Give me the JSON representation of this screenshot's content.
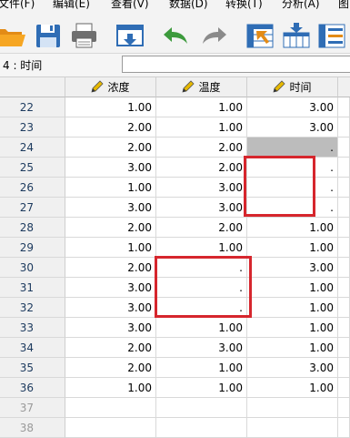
{
  "menu": [
    "文件(F)",
    "编辑(E)",
    "查看(V)",
    "数据(D)",
    "转换(T)",
    "分析(A)",
    "图"
  ],
  "toolbar": [
    "folder-open-icon",
    "save-icon",
    "print-icon",
    "dialog-recall-icon",
    "undo-icon",
    "redo-icon",
    "goto-case-icon",
    "goto-variable-icon",
    "variables-icon"
  ],
  "cell_ref": "4 : 时间",
  "cell_value": "",
  "columns": [
    "浓度",
    "温度",
    "时间"
  ],
  "rows": [
    {
      "n": "22",
      "c": [
        "1.00",
        "1.00",
        "3.00"
      ]
    },
    {
      "n": "23",
      "c": [
        "2.00",
        "1.00",
        "3.00"
      ]
    },
    {
      "n": "24",
      "c": [
        "2.00",
        "2.00",
        "."
      ]
    },
    {
      "n": "25",
      "c": [
        "3.00",
        "2.00",
        "."
      ]
    },
    {
      "n": "26",
      "c": [
        "1.00",
        "3.00",
        "."
      ]
    },
    {
      "n": "27",
      "c": [
        "3.00",
        "3.00",
        "."
      ]
    },
    {
      "n": "28",
      "c": [
        "2.00",
        "2.00",
        "1.00"
      ]
    },
    {
      "n": "29",
      "c": [
        "1.00",
        "1.00",
        "1.00"
      ]
    },
    {
      "n": "30",
      "c": [
        "2.00",
        ".",
        "3.00"
      ]
    },
    {
      "n": "31",
      "c": [
        "3.00",
        ".",
        "1.00"
      ]
    },
    {
      "n": "32",
      "c": [
        "3.00",
        ".",
        "1.00"
      ]
    },
    {
      "n": "33",
      "c": [
        "3.00",
        "1.00",
        "1.00"
      ]
    },
    {
      "n": "34",
      "c": [
        "2.00",
        "3.00",
        "1.00"
      ]
    },
    {
      "n": "35",
      "c": [
        "2.00",
        "1.00",
        "3.00"
      ]
    },
    {
      "n": "36",
      "c": [
        "1.00",
        "1.00",
        "1.00"
      ]
    },
    {
      "n": "37",
      "c": [
        "",
        "",
        ""
      ]
    },
    {
      "n": "38",
      "c": [
        "",
        "",
        ""
      ]
    }
  ],
  "colors": {
    "highlight": "#d6262d",
    "selected_cell": "#bcbcbc"
  }
}
